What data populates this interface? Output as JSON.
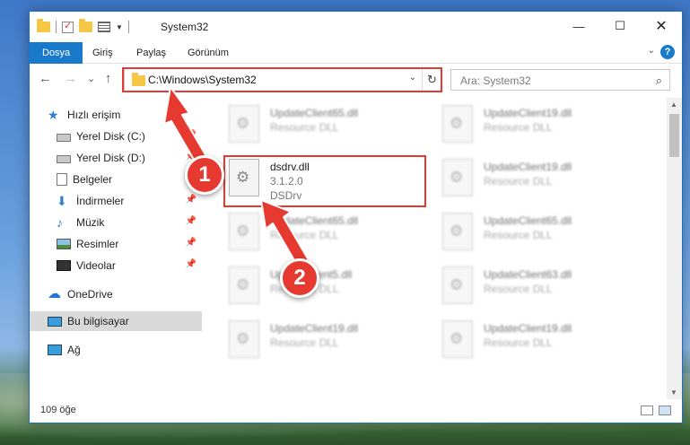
{
  "window": {
    "title": "System32",
    "buttons": {
      "minimize": "—",
      "maximize": "☐",
      "close": "✕"
    }
  },
  "ribbon": {
    "tabs": [
      "Dosya",
      "Giriş",
      "Paylaş",
      "Görünüm"
    ],
    "help": "?",
    "collapse": "⌄"
  },
  "nav": {
    "back": "←",
    "forward": "→",
    "recent": "⌄",
    "up": "↑",
    "address": "C:\\Windows\\System32",
    "address_dropdown": "⌄",
    "refresh": "↻",
    "search_placeholder": "Ara: System32",
    "search_icon": "⌕"
  },
  "sidebar": {
    "items": [
      {
        "label": "Hızlı erişim",
        "icon": "star-icon",
        "pinned": false
      },
      {
        "label": "Yerel Disk (C:)",
        "icon": "drive-icon",
        "pinned": true
      },
      {
        "label": "Yerel Disk (D:)",
        "icon": "drive-icon",
        "pinned": true
      },
      {
        "label": "Belgeler",
        "icon": "documents-icon",
        "pinned": true
      },
      {
        "label": "İndirmeler",
        "icon": "downloads-icon",
        "pinned": true
      },
      {
        "label": "Müzik",
        "icon": "music-icon",
        "pinned": true
      },
      {
        "label": "Resimler",
        "icon": "pictures-icon",
        "pinned": true
      },
      {
        "label": "Videolar",
        "icon": "videos-icon",
        "pinned": true
      },
      {
        "label": "OneDrive",
        "icon": "onedrive-icon",
        "pinned": false
      },
      {
        "label": "Bu bilgisayar",
        "icon": "this-pc-icon",
        "pinned": false,
        "selected": true
      },
      {
        "label": "Ağ",
        "icon": "network-icon",
        "pinned": false
      }
    ],
    "pin_glyph": "📌"
  },
  "files": {
    "left": [
      {
        "name": "UpdateClient65.dll",
        "type": "Resource DLL"
      },
      {
        "name": "dsdrv.dll",
        "version": "3.1.2.0",
        "type": "DSDrv",
        "highlighted": true
      },
      {
        "name": "UpdateClient65.dll",
        "type": "Resource DLL"
      },
      {
        "name": "UpdateClient5.dll",
        "type": "Resource DLL"
      },
      {
        "name": "UpdateClient19.dll",
        "type": "Resource DLL"
      }
    ],
    "right": [
      {
        "name": "UpdateClient19.dll",
        "type": "Resource DLL"
      },
      {
        "name": "UpdateClient19.dll",
        "type": "Resource DLL"
      },
      {
        "name": "UpdateClient65.dll",
        "type": "Resource DLL"
      },
      {
        "name": "UpdateClient63.dll",
        "type": "Resource DLL"
      },
      {
        "name": "UpdateClient19.dll",
        "type": "Resource DLL"
      }
    ]
  },
  "status": {
    "count": "109 öğe"
  },
  "markers": [
    "1",
    "2"
  ],
  "colors": {
    "accent": "#1979ca",
    "highlight": "#e6392f"
  }
}
